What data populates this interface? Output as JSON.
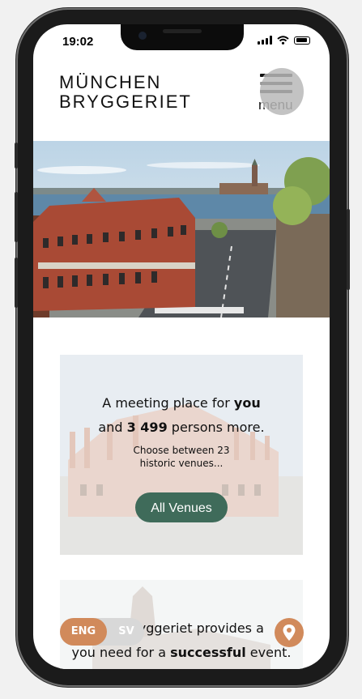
{
  "status_bar": {
    "time": "19:02"
  },
  "header": {
    "logo_line1": "MÜNCHEN",
    "logo_line2": "BRYGGERIET",
    "menu_label": "menu"
  },
  "venue_card": {
    "line1_prefix": "A meeting place for ",
    "line1_bold": "you",
    "line2_prefix": "and ",
    "line2_bold": "3 499",
    "line2_suffix": " persons more.",
    "sub_line1": "Choose between 23",
    "sub_line2": "historic venues...",
    "button_label": "All Venues"
  },
  "about_card": {
    "line1": "bryggeriet provides a",
    "line2_prefix": "you need for a ",
    "line2_bold": "successful",
    "line2_suffix": " event."
  },
  "language_toggle": {
    "active": "ENG",
    "inactive": "SV"
  },
  "colors": {
    "accent": "#d18a5b",
    "button_green": "#3f6b5a"
  },
  "icons": [
    "wifi-icon",
    "signal-icon",
    "battery-icon",
    "hamburger-icon",
    "location-pin-icon"
  ]
}
